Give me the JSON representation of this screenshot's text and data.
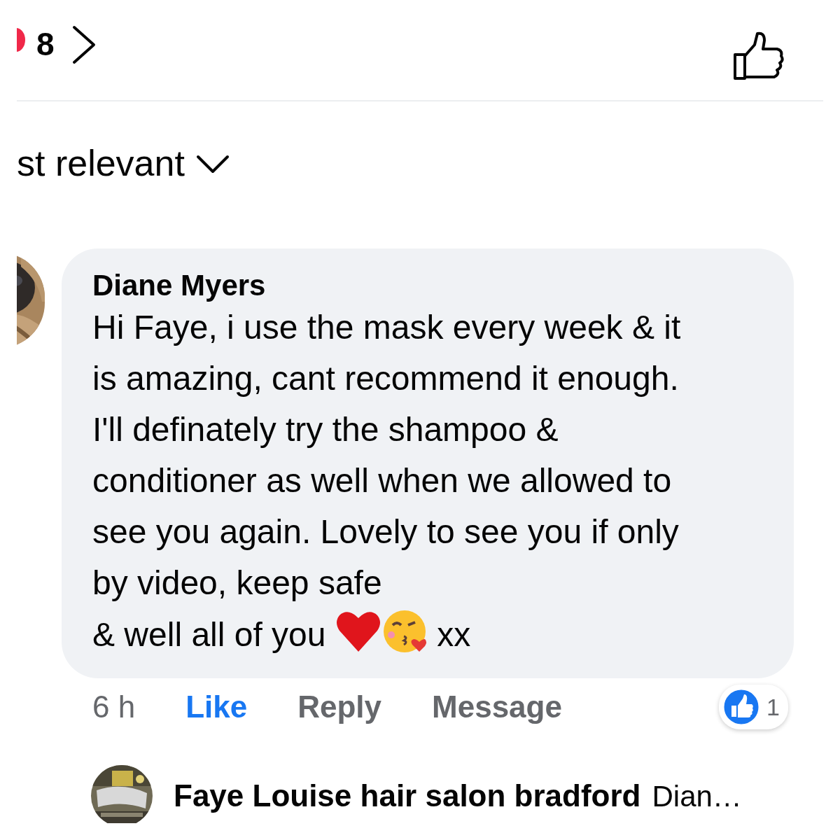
{
  "header": {
    "reaction_count": "8"
  },
  "sort": {
    "label": "st relevant"
  },
  "comment": {
    "author": "Diane Myers",
    "text": "Hi Faye, i use the mask every week & it is amazing, cant recommend it enough. I'll definately try the shampoo & conditioner as well when we allowed to see you again. Lovely to see you if only by video, keep safe",
    "last_line": "& well all of you",
    "suffix": "xx",
    "time": "6 h",
    "actions": [
      {
        "label": "Like",
        "active": true
      },
      {
        "label": "Reply",
        "active": false
      },
      {
        "label": "Message",
        "active": false
      }
    ],
    "reactions": {
      "count": "1"
    }
  },
  "reply_preview": {
    "author": "Faye Louise hair salon bradford",
    "text": "Dian…"
  }
}
